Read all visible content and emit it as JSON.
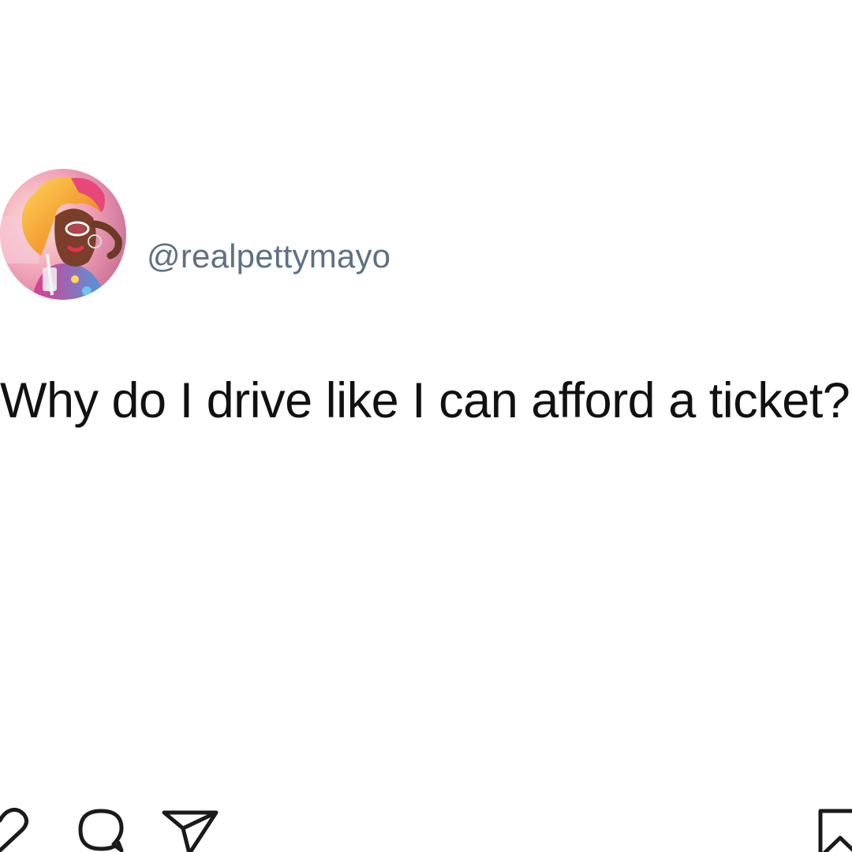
{
  "post": {
    "author_handle": "@realpettymayo",
    "text": "Why do I drive like I can afford a ticket?"
  },
  "actions": {
    "icons": [
      "heart-icon",
      "comment-icon",
      "share-icon",
      "save-icon"
    ]
  },
  "colors": {
    "background": "#ffffff",
    "handle": "#5d7183",
    "text": "#111111"
  }
}
